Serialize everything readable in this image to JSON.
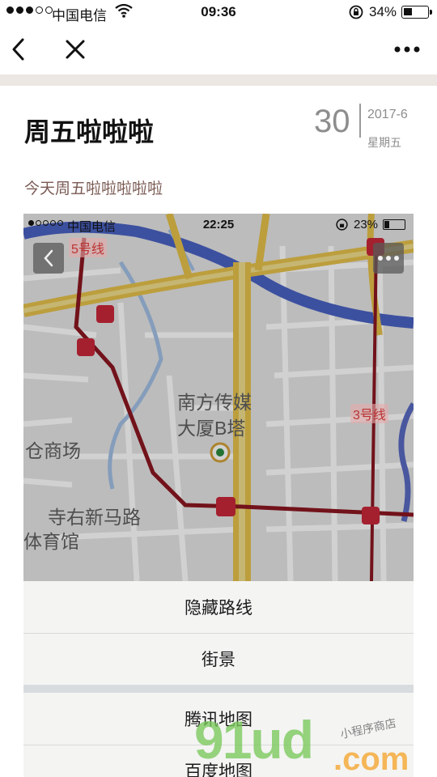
{
  "status_bar": {
    "carrier": "中国电信",
    "time": "09:36",
    "battery_percent": "34%",
    "battery_level": 0.34
  },
  "nav": {
    "back_icon": "chevron-left-icon",
    "close_icon": "close-icon",
    "more_icon": "more-dots-icon"
  },
  "article": {
    "title": "周五啦啦啦",
    "day": "30",
    "year_month": "2017-6",
    "weekday": "星期五",
    "subtitle": "今天周五啦啦啦啦啦"
  },
  "embedded_screenshot": {
    "status_bar": {
      "carrier": "中国电信",
      "time": "22:25",
      "battery_percent": "23%",
      "battery_level": 0.23
    },
    "map_labels": {
      "poi_name_line1": "南方传媒",
      "poi_name_line2": "大厦B塔",
      "mall": "仓商场",
      "road": "寺右新马路",
      "stadium": "体育馆",
      "line5": "5号线",
      "line3": "3号线"
    },
    "action_sheet": {
      "items": [
        "隐藏路线",
        "街景",
        "腾讯地图",
        "百度地图"
      ]
    }
  },
  "watermark": {
    "brand_main": "91ud",
    "brand_suffix": ".com",
    "tagline": "小程序商店"
  }
}
